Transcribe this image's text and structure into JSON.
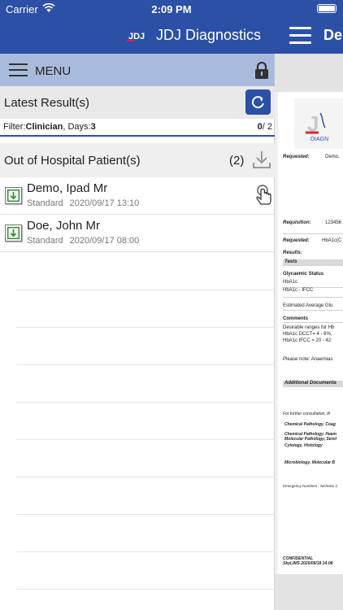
{
  "status_bar": {
    "carrier": "Carrier",
    "time": "2:09 PM"
  },
  "navbar": {
    "title": "JDJ Diagnostics",
    "second_title_partial": "De"
  },
  "menu": {
    "label": "MENU"
  },
  "latest_results": {
    "label": "Latest Result(s)"
  },
  "filter": {
    "prefix": "Filter:",
    "role": "Clinician",
    "days_text": ", Days:",
    "days": "3",
    "count_selected": "0",
    "count_total": "/ 2"
  },
  "group": {
    "label": "Out of Hospital Patient(s)",
    "count": "(2)"
  },
  "patients": [
    {
      "name": "Demo, Ipad Mr",
      "priority": "Standard",
      "datetime": "2020/09/17 13:10"
    },
    {
      "name": "Doe, John Mr",
      "priority": "Standard",
      "datetime": "2020/09/17 08:00"
    }
  ],
  "preview": {
    "requested_label": "Requested:",
    "requested_value": "Demo,",
    "requisition_label": "Requisition:",
    "requisition_value": "123456",
    "requested2_label": "Requested:",
    "requested2_value": "HbA1c(C",
    "results_label": "Results:",
    "tests_label": "Tests",
    "glycaemic_label": "Glycaemic Status",
    "hba1c": "HbA1c",
    "hba1c_ifcc": "HbA1c - IFCC",
    "estimated": "Estimated Average Glu",
    "comments_label": "Comments",
    "comment1": "Desirable ranges for Hb",
    "comment2": "HbA1c DCCT= 4 - 6%,",
    "comment3": "HbA1c IFCC = 20 - 42",
    "comment4": "Please note: Anaemias",
    "additional": "Additional Documenta",
    "consult": "For further consultation, th",
    "dept1": "Chemical Pathology, Coag",
    "dept2": "Chemical Pathology, Haem",
    "dept3": "Molecular Pathology, Serol",
    "dept4": "Cytology, Histology",
    "dept5": "Microbiology, Molecular B",
    "emergency": "Emergency Numbers : Nicholas C",
    "confidential": "CONFIDENTIAL",
    "skylims": "SkyLIMS 2020/09/18 14:08"
  },
  "colors": {
    "brand": "#2b50a5",
    "menubar": "#a9bbdc"
  }
}
